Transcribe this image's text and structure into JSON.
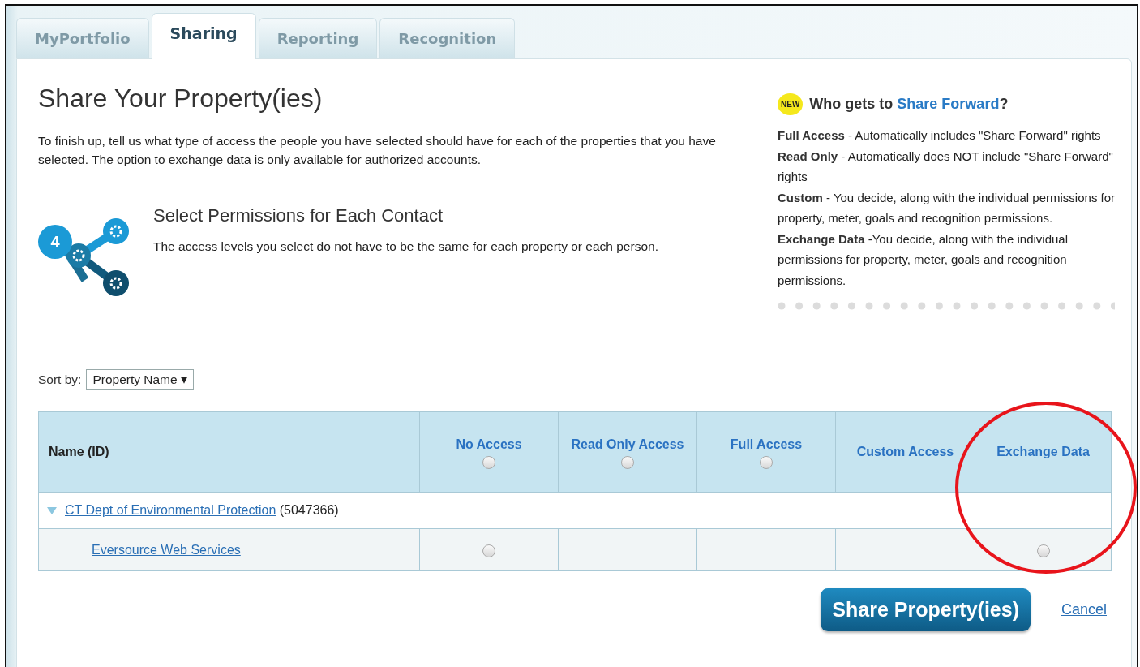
{
  "tabs": [
    {
      "label": "MyPortfolio",
      "selected": false
    },
    {
      "label": "Sharing",
      "selected": true
    },
    {
      "label": "Reporting",
      "selected": false
    },
    {
      "label": "Recognition",
      "selected": false
    }
  ],
  "title": "Share Your Property(ies)",
  "intro": "To finish up, tell us what type of access the people you have selected should have for each of the properties that you have selected. The option to exchange data is only available for authorized accounts.",
  "step": {
    "number": "4",
    "heading": "Select Permissions for Each Contact",
    "text": "The access levels you select do not have to be the same for each property or each person."
  },
  "note": {
    "badge": "NEW",
    "heading": "Who gets to",
    "heading_link": "Share Forward",
    "heading_end": "?",
    "entries": [
      "**Full Access** - Automatically includes \"Share Forward\" rights",
      "**Read Only** - Automatically does NOT include \"Share Forward\" rights",
      "**Custom** - You decide, along with the individual permissions for property, meter, goals and recognition permissions.",
      "**Exchange Data** -You decide, along with the individual permissions for property, meter, goals and recognition permissions."
    ]
  },
  "sort": {
    "label": "Sort by:",
    "value": "Property Name ▾"
  },
  "table": {
    "columns": [
      {
        "label": "Name (ID)",
        "kind": "name"
      },
      {
        "label": "No Access",
        "kind": "radio",
        "checked": false
      },
      {
        "label": "Read Only Access",
        "kind": "radio",
        "checked": false
      },
      {
        "label": "Full Access",
        "kind": "radio",
        "checked": false
      },
      {
        "label": "Custom Access",
        "kind": "plain"
      },
      {
        "label": "Exchange Data",
        "kind": "plain"
      }
    ],
    "rows": [
      {
        "kind": "property",
        "expanded": true,
        "name": "CT Dept of Environmental Protection",
        "id": "(5047366)"
      },
      {
        "kind": "contact",
        "name": "Eversource Web Services",
        "cells": [
          {
            "kind": "radio",
            "checked": false
          },
          {
            "kind": "empty"
          },
          {
            "kind": "empty"
          },
          {
            "kind": "empty"
          },
          {
            "kind": "radio",
            "checked": false
          }
        ]
      }
    ]
  },
  "buttons": {
    "primary": "Share Property(ies)",
    "cancel": "Cancel"
  }
}
